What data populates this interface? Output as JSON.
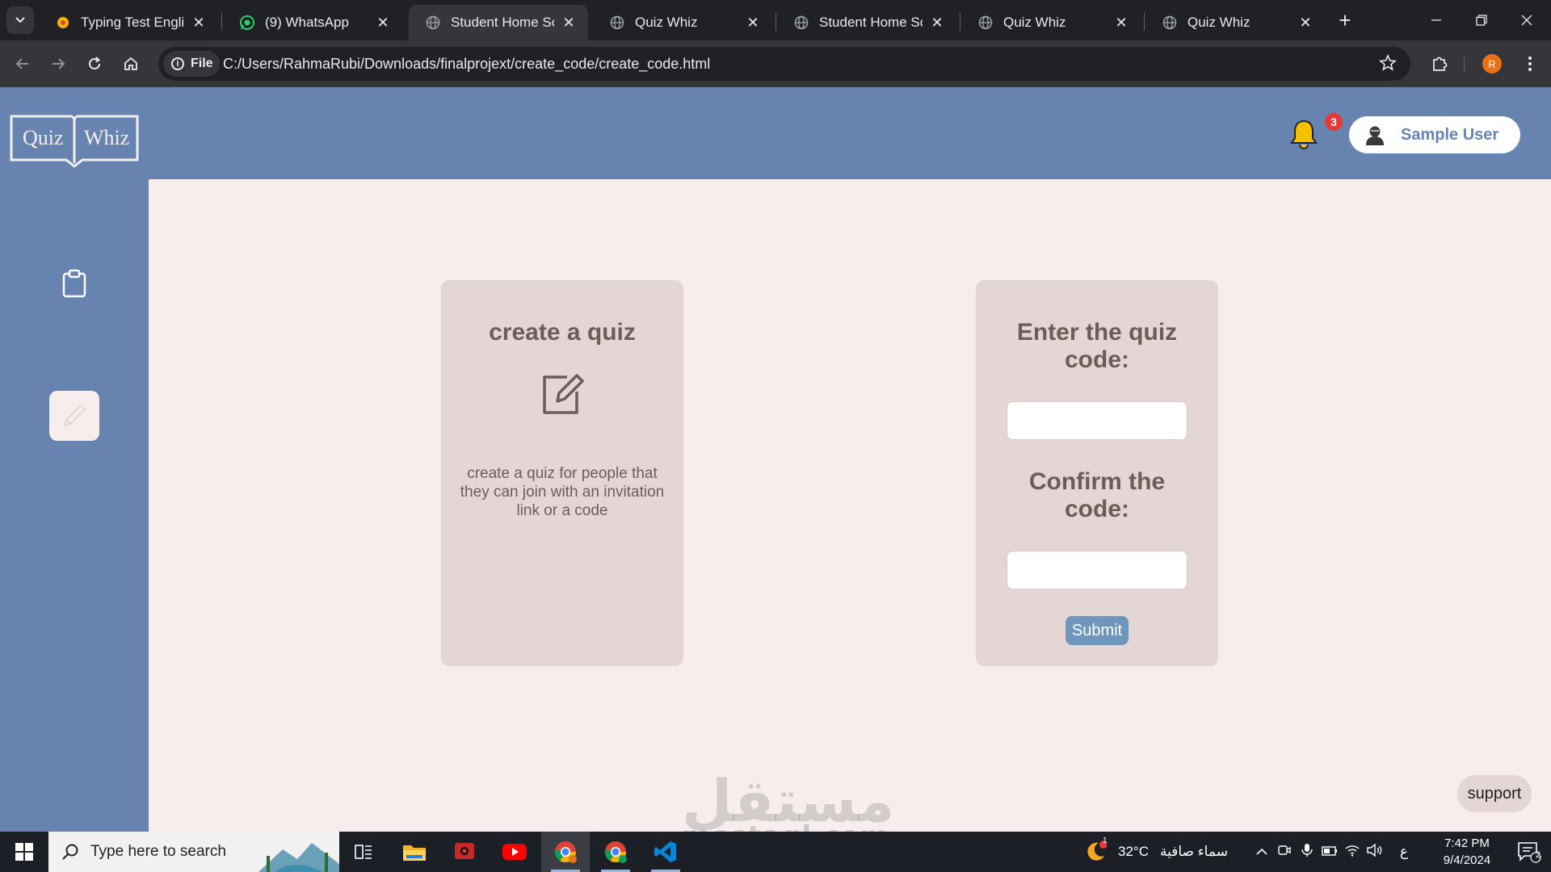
{
  "browser": {
    "tabs": [
      {
        "title": "Typing Test English -",
        "icon": "typing-test-favicon",
        "active": false
      },
      {
        "title": "(9) WhatsApp",
        "icon": "whatsapp-icon",
        "active": false
      },
      {
        "title": "Student Home Screen",
        "icon": "globe-icon",
        "active": true
      },
      {
        "title": "Quiz Whiz",
        "icon": "globe-icon",
        "active": false
      },
      {
        "title": "Student Home Screen",
        "icon": "globe-icon",
        "active": false
      },
      {
        "title": "Quiz Whiz",
        "icon": "globe-icon",
        "active": false
      },
      {
        "title": "Quiz Whiz",
        "icon": "globe-icon",
        "active": false
      }
    ],
    "address": {
      "chip_label": "File",
      "url": "C:/Users/RahmaRubi/Downloads/finalprojext/create_code/create_code.html"
    },
    "profile_initial": "R"
  },
  "app": {
    "logo": {
      "left": "Quiz",
      "right": "Whiz"
    },
    "notifications": {
      "count": "3"
    },
    "user": {
      "name": "Sample User"
    },
    "sidebar": [
      {
        "icon": "clipboard-icon",
        "active": false
      },
      {
        "icon": "pencil-icon",
        "active": true
      }
    ],
    "create_card": {
      "title": "create a quiz",
      "icon": "edit-icon",
      "description": "create a quiz for people that they can join with an invitation link or a code"
    },
    "code_card": {
      "enter_label": "Enter the quiz code:",
      "enter_value": "",
      "confirm_label": "Confirm the code:",
      "confirm_value": "",
      "submit_label": "Submit"
    },
    "support_label": "support",
    "watermark": {
      "arabic": "مستقل",
      "latin": "mostaql.com"
    }
  },
  "taskbar": {
    "search_placeholder": "Type here to search",
    "apps": [
      "task-view-icon",
      "file-explorer-icon",
      "screen-recorder-icon",
      "youtube-icon",
      "chrome-icon",
      "chrome-icon",
      "vscode-icon"
    ],
    "weather": {
      "temp": "32°C",
      "condition": "سماء صافية",
      "badge": "1"
    },
    "language": "ع",
    "time": "7:42 PM",
    "date": "9/4/2024",
    "notification_count": "2"
  },
  "colors": {
    "brand_blue": "#6784b0",
    "page_bg": "#f7eded",
    "card_bg": "#e4d6d4",
    "text_brown": "#6b5e58",
    "submit_blue": "#6f96bd",
    "badge_red": "#e53935"
  }
}
